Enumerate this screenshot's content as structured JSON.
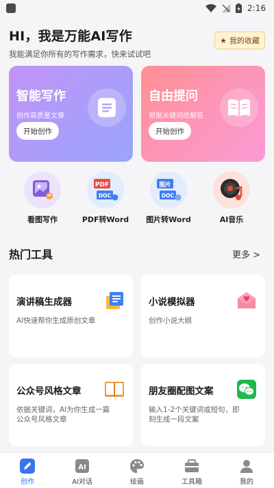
{
  "status_bar": {
    "time": "2:16"
  },
  "header": {
    "title": "HI，我是万能AI写作",
    "subtitle": "我能满足你所有的写作需求，快来试试吧",
    "favorites_label": "我的收藏"
  },
  "feature_cards": [
    {
      "title": "智能写作",
      "subtitle": "创作高质量文章",
      "button": "开始创作",
      "icon": "document-icon"
    },
    {
      "title": "自由提问",
      "subtitle": "根据关键词给解答",
      "button": "开始创作",
      "icon": "book-icon"
    }
  ],
  "quick_tools": [
    {
      "label": "看图写作",
      "icon": "picture-icon"
    },
    {
      "label": "PDF转Word",
      "icon": "pdf-doc-icon",
      "badge": "PDF",
      "sub": "DOC"
    },
    {
      "label": "图片转Word",
      "icon": "image-doc-icon",
      "badge": "图片",
      "sub": "DOC"
    },
    {
      "label": "AI音乐",
      "icon": "music-record-icon"
    }
  ],
  "hot_tools": {
    "title": "热门工具",
    "more": "更多 >",
    "items": [
      {
        "title": "演讲稿生成器",
        "desc": "AI快速帮你生成原创文章",
        "icon": "clipboard-icon"
      },
      {
        "title": "小说模拟器",
        "desc": "创作小说大纲",
        "icon": "envelope-heart-icon"
      },
      {
        "title": "公众号风格文章",
        "desc": "依据关键词，AI为你生成一篇公众号风格文章",
        "icon": "open-book-icon"
      },
      {
        "title": "朋友圈配图文案",
        "desc": "输入1-2个关键词或短句，即刻生成一段文案",
        "icon": "wechat-icon"
      }
    ]
  },
  "tabbar": {
    "tabs": [
      {
        "label": "创作",
        "icon": "pen-icon",
        "active": true
      },
      {
        "label": "AI对话",
        "icon": "ai-chat-icon",
        "active": false
      },
      {
        "label": "绘画",
        "icon": "palette-icon",
        "active": false
      },
      {
        "label": "工具箱",
        "icon": "toolbox-icon",
        "active": false
      },
      {
        "label": "我的",
        "icon": "user-icon",
        "active": false
      }
    ]
  },
  "colors": {
    "accent": "#3a72f0",
    "purple_card": "#b598f8",
    "pink_card": "#fd92b8",
    "fav_bg": "#fff3d6"
  }
}
